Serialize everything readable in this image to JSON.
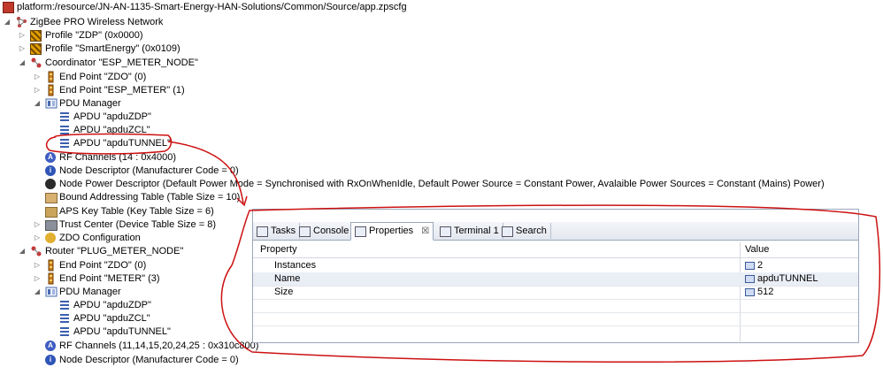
{
  "tree": {
    "root_path": "platform:/resource/JN-AN-1135-Smart-Energy-HAN-Solutions/Common/Source/app.zpscfg",
    "network": "ZigBee PRO Wireless Network",
    "profile_zdp": "Profile \"ZDP\" (0x0000)",
    "profile_se": "Profile \"SmartEnergy\" (0x0109)",
    "coordinator": "Coordinator \"ESP_METER_NODE\"",
    "coord_ep_zdo": "End Point \"ZDO\" (0)",
    "coord_ep_esp": "End Point \"ESP_METER\" (1)",
    "coord_pdu": "PDU Manager",
    "coord_apdu_zdp": "APDU \"apduZDP\"",
    "coord_apdu_zcl": "APDU \"apduZCL\"",
    "coord_apdu_tunnel": "APDU \"apduTUNNEL\"",
    "coord_rf": "RF Channels (14 : 0x4000)",
    "coord_node_desc": "Node Descriptor (Manufacturer Code = 0)",
    "coord_power_desc": "Node Power Descriptor (Default Power Mode = Synchronised with RxOnWhenIdle, Default Power Source = Constant Power, Avalaible Power Sources = Constant (Mains) Power)",
    "coord_bound": "Bound Addressing Table (Table Size = 10)",
    "coord_aps": "APS Key Table (Key Table Size = 6)",
    "coord_trust": "Trust Center (Device Table Size = 8)",
    "coord_zdo_cfg": "ZDO Configuration",
    "router": "Router \"PLUG_METER_NODE\"",
    "router_ep_zdo": "End Point \"ZDO\" (0)",
    "router_ep_meter": "End Point \"METER\" (3)",
    "router_pdu": "PDU Manager",
    "router_apdu_zdp": "APDU \"apduZDP\"",
    "router_apdu_zcl": "APDU \"apduZCL\"",
    "router_apdu_tunnel": "APDU \"apduTUNNEL\"",
    "router_rf": "RF Channels (11,14,15,20,24,25 : 0x310c800)",
    "router_node_desc": "Node Descriptor (Manufacturer Code = 0)"
  },
  "view": {
    "tabs": {
      "tasks": "Tasks",
      "console": "Console",
      "properties": "Properties",
      "properties_close": "☒",
      "terminal": "Terminal 1",
      "search": "Search"
    },
    "columns": {
      "property": "Property",
      "value": "Value"
    },
    "rows": {
      "instances": {
        "property": "Instances",
        "value": "2"
      },
      "name": {
        "property": "Name",
        "value": "apduTUNNEL"
      },
      "size": {
        "property": "Size",
        "value": "512"
      }
    }
  },
  "colors": {
    "annotation": "#cc1111",
    "selection": "#eaeef5"
  }
}
